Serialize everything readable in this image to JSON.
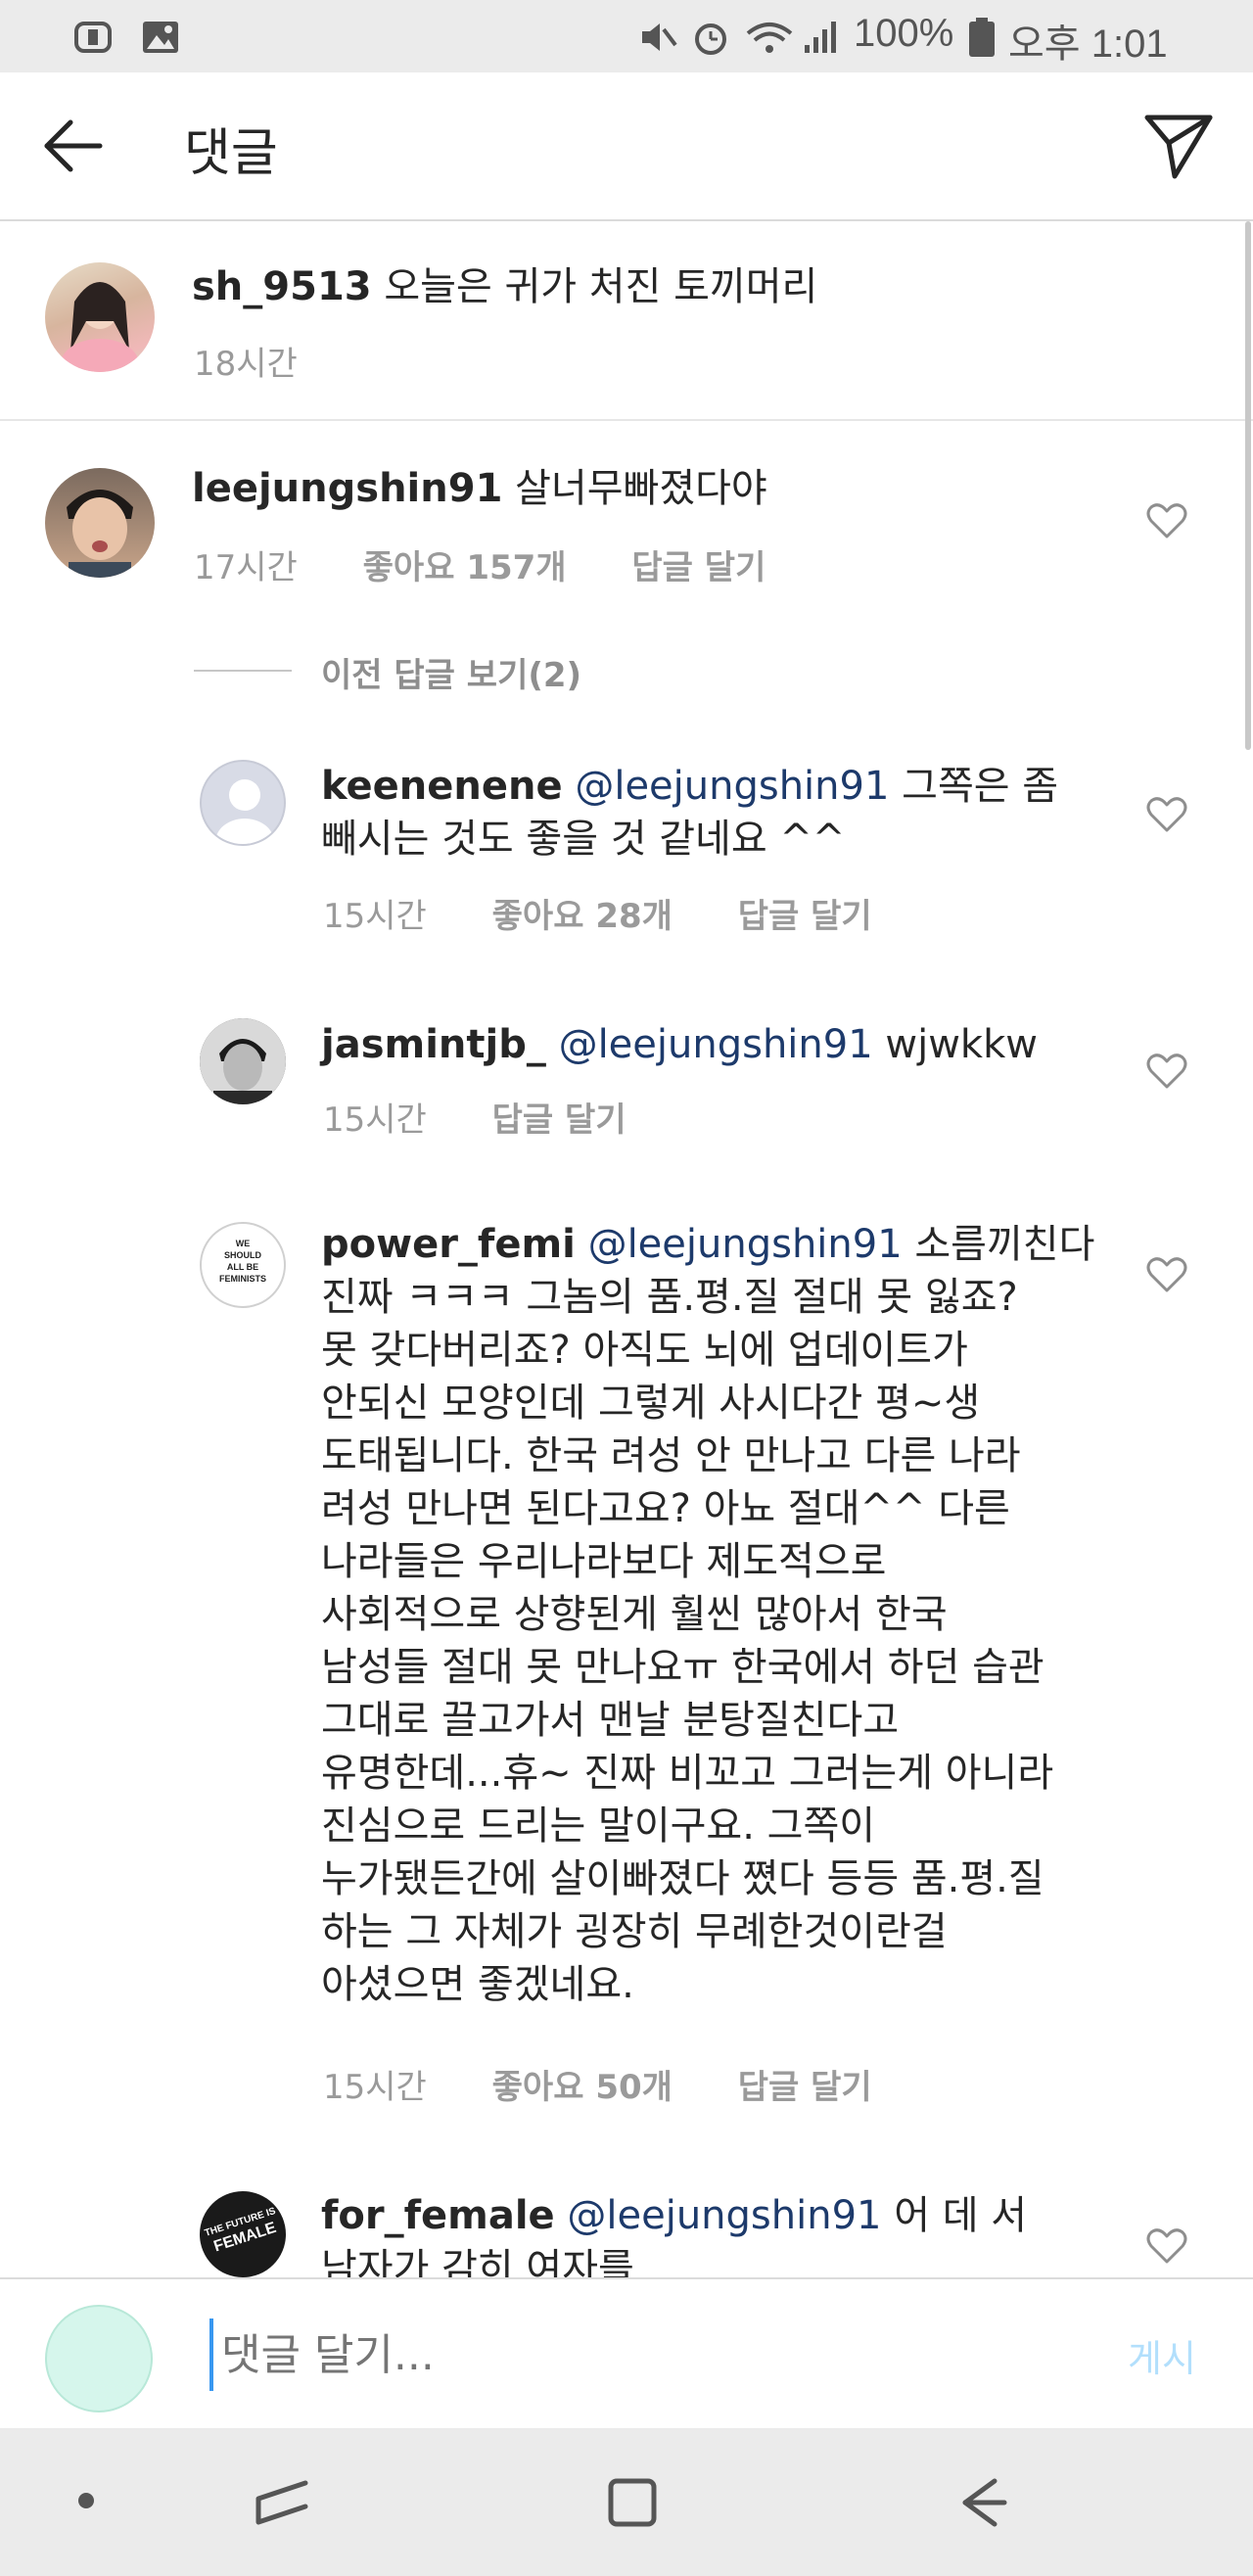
{
  "status_bar": {
    "battery": "100%",
    "time": "오후 1:01"
  },
  "header": {
    "title": "댓글"
  },
  "caption": {
    "username": "sh_9513",
    "text": "오늘은 귀가 처진 토끼머리",
    "time": "18시간"
  },
  "comments": [
    {
      "username": "leejungshin91",
      "text": "살너무빠졌다야",
      "time": "17시간",
      "likes": "좋아요 157개",
      "reply": "답글 달기"
    }
  ],
  "view_replies": "이전 답글 보기(2)",
  "replies": [
    {
      "username": "keenenene",
      "mention": "@leejungshin91",
      "lines": [
        "그쪽은 좀",
        "빼시는 것도 좋을 것 같네요 ^^"
      ],
      "time": "15시간",
      "likes": "좋아요 28개",
      "reply": "답글 달기"
    },
    {
      "username": "jasmintjb_",
      "mention": "@leejungshin91",
      "lines": [
        "wjwkkw"
      ],
      "time": "15시간",
      "reply": "답글 달기"
    },
    {
      "username": "power_femi",
      "mention": "@leejungshin91",
      "avatar_text": [
        "WE",
        "SHOULD",
        "ALL BE",
        "FEMINISTS"
      ],
      "lines": [
        "소름끼친다",
        "진짜 ㅋㅋㅋ 그놈의 품.평.질 절대 못 잃죠?",
        "못 갖다버리죠? 아직도 뇌에 업데이트가",
        "안되신 모양인데 그렇게 사시다간 평~생",
        "도태됩니다. 한국 려성 안 만나고 다른 나라",
        "려성 만나면 된다고요? 아뇨 절대^^ 다른",
        "나라들은 우리나라보다 제도적으로",
        "사회적으로 상향된게 훨씬 많아서 한국",
        "남성들 절대 못 만나요ㅠ 한국에서 하던 습관",
        "그대로 끌고가서 맨날 분탕질친다고",
        "유명한데...휴~ 진짜 비꼬고 그러는게 아니라",
        "진심으로 드리는 말이구요. 그쪽이",
        "누가됐든간에 살이빠졌다 쪘다 등등 품.평.질",
        "하는 그 자체가 굉장히 무례한것이란걸",
        "아셨으면 좋겠네요."
      ],
      "time": "15시간",
      "likes": "좋아요 50개",
      "reply": "답글 달기"
    },
    {
      "username": "for_female",
      "mention": "@leejungshin91",
      "avatar_text": [
        "THE FUTURE IS",
        "FEMALE"
      ],
      "lines": [
        "어 데 서",
        "남자가 감히 여자를"
      ]
    }
  ],
  "input": {
    "placeholder": "댓글 달기...",
    "post_label": "게시"
  },
  "colors": {
    "mention": "#1d3a6b",
    "meta": "#9a9a9a",
    "post_disabled": "#b2dffc",
    "input_avatar": "#d6f6ec"
  }
}
